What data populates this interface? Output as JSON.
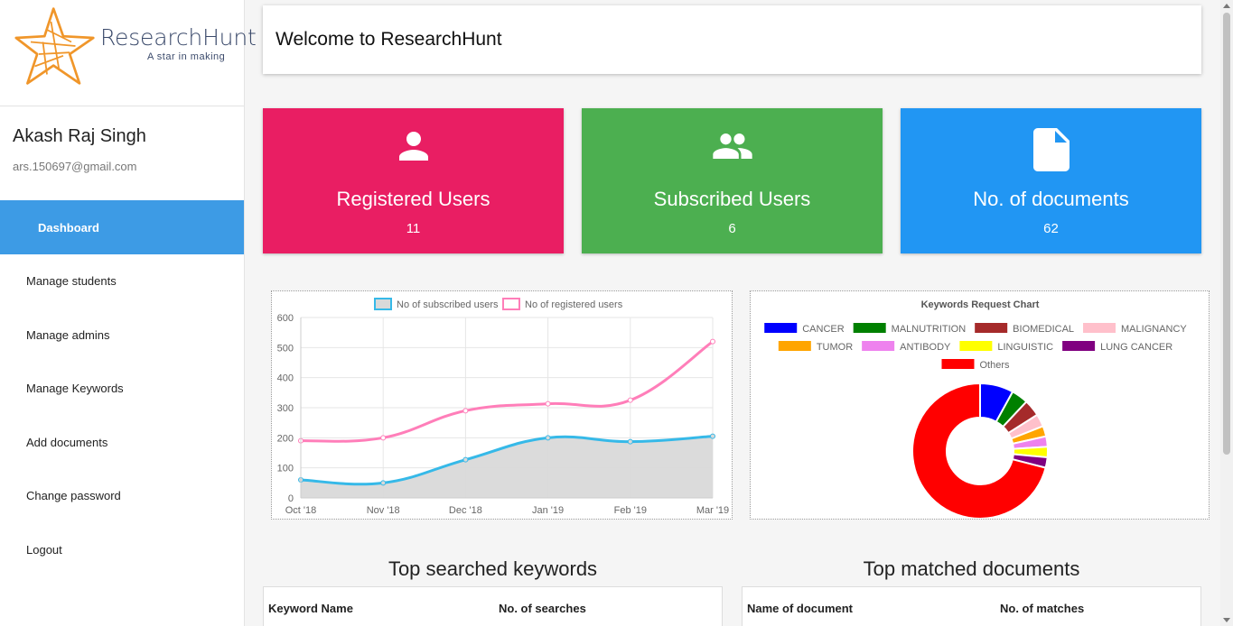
{
  "brand": {
    "name": "ResearchHunt",
    "tagline": "A star in making"
  },
  "user": {
    "name": "Akash Raj Singh",
    "email": "ars.150697@gmail.com"
  },
  "nav": [
    {
      "label": "Dashboard"
    },
    {
      "label": "Manage students"
    },
    {
      "label": "Manage admins"
    },
    {
      "label": "Manage Keywords"
    },
    {
      "label": "Add documents"
    },
    {
      "label": "Change password"
    },
    {
      "label": "Logout"
    }
  ],
  "welcome": "Welcome to ResearchHunt",
  "cards": [
    {
      "label": "Registered Users",
      "value": "11",
      "icon": "person-icon",
      "color": "#e91e63"
    },
    {
      "label": "Subscribed Users",
      "value": "6",
      "icon": "people-icon",
      "color": "#4caf50"
    },
    {
      "label": "No. of documents",
      "value": "62",
      "icon": "document-icon",
      "color": "#2196f3"
    }
  ],
  "chart_data": [
    {
      "type": "line",
      "categories": [
        "Oct '18",
        "Nov '18",
        "Dec '18",
        "Jan '19",
        "Feb '19",
        "Mar '19"
      ],
      "series": [
        {
          "name": "No of subscribed users",
          "values": [
            60,
            50,
            127,
            200,
            187,
            205
          ],
          "color": "#36b9e8",
          "fill": "#d9d9d9"
        },
        {
          "name": "No of registered users",
          "values": [
            190,
            200,
            290,
            313,
            325,
            520
          ],
          "color": "#ff7eb9"
        }
      ],
      "ylim": [
        0,
        600
      ],
      "yticks": [
        0,
        100,
        200,
        300,
        400,
        500,
        600
      ],
      "grid": true,
      "legend": "top"
    },
    {
      "type": "pie",
      "title": "Keywords Request Chart",
      "legend": "top",
      "labels": [
        "CANCER",
        "MALNUTRITION",
        "BIOMEDICAL",
        "MALIGNANCY",
        "TUMOR",
        "ANTIBODY",
        "LINGUISTIC",
        "LUNG CANCER",
        "Others"
      ],
      "values": [
        8,
        4,
        4,
        3,
        2.5,
        2.5,
        2.5,
        2.5,
        71
      ],
      "colors": [
        "#0000ff",
        "#008000",
        "#a52a2a",
        "#ffc0cb",
        "#ffa500",
        "#ee82ee",
        "#ffff00",
        "#800080",
        "#ff0000"
      ]
    }
  ],
  "keywords_table": {
    "title": "Top searched keywords",
    "headers": [
      "Keyword Name",
      "No. of searches"
    ]
  },
  "documents_table": {
    "title": "Top matched documents",
    "headers": [
      "Name of document",
      "No. of matches"
    ]
  }
}
